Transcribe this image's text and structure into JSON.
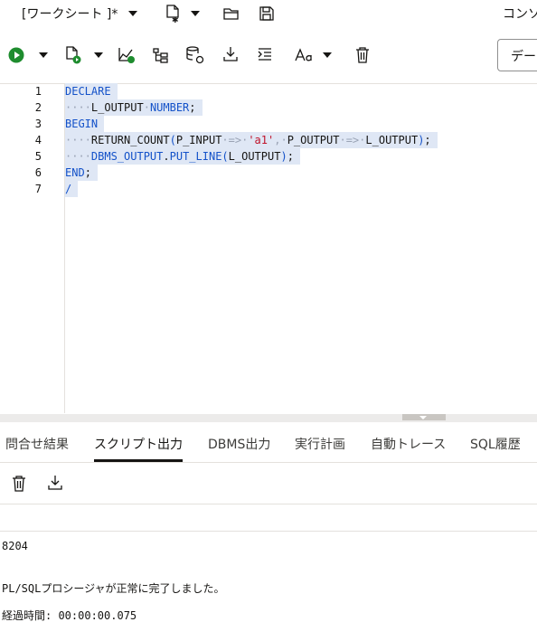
{
  "top_bar": {
    "worksheet_label": "[ワークシート ]*",
    "right_label": "コンソ"
  },
  "toolbar": {
    "connection_label": "デー"
  },
  "editor": {
    "line_numbers": [
      "1",
      "2",
      "3",
      "4",
      "5",
      "6",
      "7"
    ],
    "lines": {
      "l1": {
        "kw": "DECLARE"
      },
      "l2": {
        "indent": "····",
        "var": "L_OUTPUT",
        "sp": "·",
        "type": "NUMBER",
        "semi": ";"
      },
      "l3": {
        "kw": "BEGIN"
      },
      "l4": {
        "indent": "····",
        "proc": "RETURN_COUNT",
        "paren_open": "(",
        "p1": "P_INPUT",
        "arrow1": "·=>·",
        "str": "'a1'",
        "comma": ",·",
        "p2": "P_OUTPUT",
        "arrow2": "·=>·",
        "p3": "L_OUTPUT",
        "paren_close": ")",
        "semi": ";"
      },
      "l5": {
        "indent": "····",
        "pkg": "DBMS_OUTPUT",
        "dot": ".",
        "fn": "PUT_LINE",
        "paren_open": "(",
        "arg": "L_OUTPUT",
        "paren_close": ")",
        "semi": ";"
      },
      "l6": {
        "kw": "END",
        "semi": ";"
      },
      "l7": {
        "kw": "/"
      }
    }
  },
  "tabs": [
    {
      "label": "問合せ結果"
    },
    {
      "label": "スクリプト出力"
    },
    {
      "label": "DBMS出力"
    },
    {
      "label": "実行計画"
    },
    {
      "label": "自動トレース"
    },
    {
      "label": "SQL履歴"
    }
  ],
  "output": {
    "value": "8204",
    "message": "PL/SQLプロシージャが正常に完了しました。",
    "elapsed": "経過時間: 00:00:00.075"
  }
}
